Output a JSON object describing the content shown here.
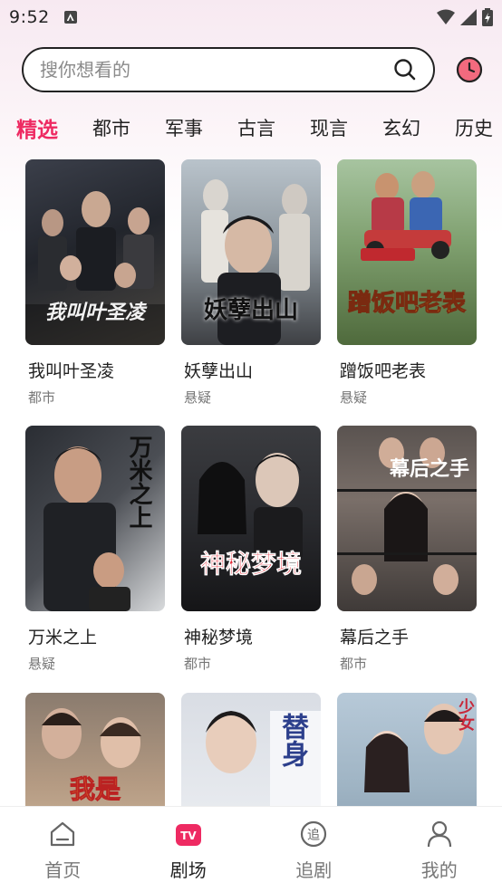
{
  "status_bar": {
    "time": "9:52"
  },
  "search": {
    "placeholder": "搜你想看的"
  },
  "tabs": [
    "精选",
    "都市",
    "军事",
    "古言",
    "现言",
    "玄幻",
    "历史"
  ],
  "dramas": [
    {
      "title": "我叫叶圣凌",
      "genre": "都市",
      "poster_text": "我叫叶圣凌"
    },
    {
      "title": "妖孽出山",
      "genre": "悬疑",
      "poster_text": "妖孽出山"
    },
    {
      "title": "蹭饭吧老表",
      "genre": "悬疑",
      "poster_text": "蹭饭吧老表"
    },
    {
      "title": "万米之上",
      "genre": "悬疑",
      "poster_text": "万米之上"
    },
    {
      "title": "神秘梦境",
      "genre": "都市",
      "poster_text": "神秘梦境"
    },
    {
      "title": "幕后之手",
      "genre": "都市",
      "poster_text": "幕后之手"
    },
    {
      "title": "",
      "genre": "",
      "poster_text": "我是"
    },
    {
      "title": "",
      "genre": "",
      "poster_text": "替身"
    },
    {
      "title": "",
      "genre": "",
      "poster_text": "少女"
    }
  ],
  "nav": [
    {
      "label": "首页",
      "icon": "home-icon"
    },
    {
      "label": "剧场",
      "icon": "tv-icon"
    },
    {
      "label": "追剧",
      "icon": "follow-icon"
    },
    {
      "label": "我的",
      "icon": "profile-icon"
    }
  ],
  "colors": {
    "accent": "#ee2a62"
  }
}
